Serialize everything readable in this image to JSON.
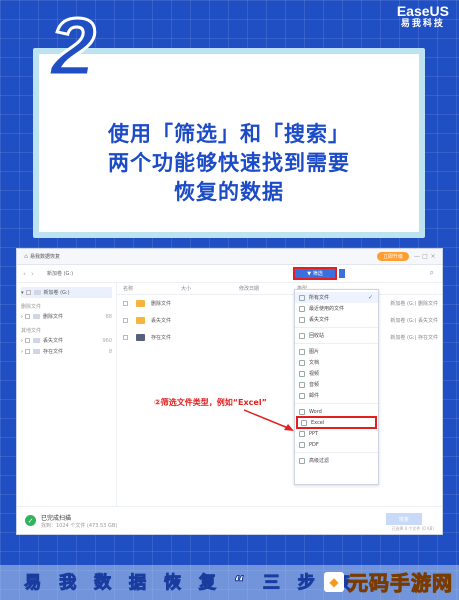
{
  "brand": {
    "name_en": "EaseUS",
    "name_cn": "易我科技"
  },
  "step": {
    "number": "2"
  },
  "headline": {
    "line1": "使用「筛选」和「搜索」",
    "line2": "两个功能够快速找到需要",
    "line3": "恢复的数据"
  },
  "app": {
    "title": "易我数据恢复",
    "upgrade_label": "立即升级",
    "window_controls": [
      "—",
      "□",
      "×"
    ],
    "breadcrumb": "新加卷 (G:)",
    "filter_label": "筛选",
    "sidebar": {
      "root": {
        "label": "新加卷 (G:)"
      },
      "group1": "删除文件",
      "items1": [
        {
          "label": "删除文件",
          "count": "88"
        }
      ],
      "group2": "其他文件",
      "items2": [
        {
          "label": "丢失文件",
          "count": "960"
        },
        {
          "label": "存在文件",
          "count": "8"
        }
      ]
    },
    "columns": [
      "名称",
      "大小",
      "修改日期",
      "类型"
    ],
    "rows": [
      {
        "name": "删除文件",
        "right": "新加卷 (G:) 删除文件",
        "dark": false
      },
      {
        "name": "丢失文件",
        "right": "新加卷 (G:) 丢失文件",
        "dark": false
      },
      {
        "name": "存在文件",
        "right": "新加卷 (G:) 存在文件",
        "dark": true
      }
    ],
    "status": {
      "title": "已完成扫描",
      "detail": "找到：1024 个文件 (473.53 GB)",
      "recover_label": "恢复",
      "right_text": "已选择 0 个文件 (0 KB)"
    }
  },
  "filter_menu": {
    "items": [
      {
        "label": "所有文件",
        "checked": true
      },
      {
        "label": "最近使用的文件"
      },
      {
        "label": "丢失文件"
      },
      {
        "sep": true
      },
      {
        "label": "回收站"
      },
      {
        "sep": true
      },
      {
        "label": "图片"
      },
      {
        "label": "文档"
      },
      {
        "label": "视频"
      },
      {
        "label": "音频"
      },
      {
        "label": "邮件"
      },
      {
        "sep": true
      },
      {
        "label": "Word"
      },
      {
        "label": "Excel",
        "boxed": true
      },
      {
        "label": "PPT"
      },
      {
        "label": "PDF"
      },
      {
        "sep": true
      },
      {
        "label": "高级过滤"
      }
    ]
  },
  "annotation": "②筛选文件类型，例如“Excel”",
  "footer": "易 我 数 据 恢 复 “ 三 步 恢",
  "watermark": "元码手游网",
  "colors": {
    "accent": "#1c4bc7",
    "highlight": "#e22020",
    "filter_button": "#3a6fe0"
  }
}
